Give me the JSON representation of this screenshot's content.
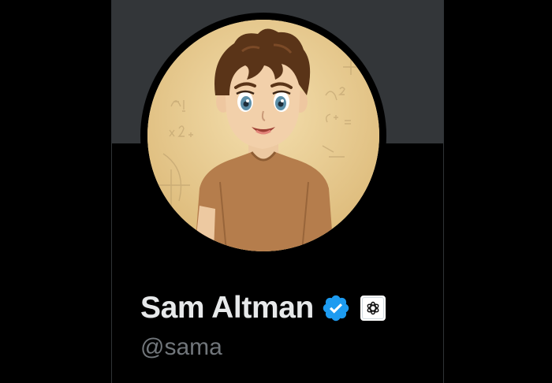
{
  "profile": {
    "display_name": "Sam Altman",
    "handle": "@sama",
    "verified": true,
    "avatar_icon": "anime-portrait-avatar",
    "affiliation_icon": "openai-logo-icon"
  },
  "colors": {
    "background": "#000000",
    "banner": "#333639",
    "name_text": "#e7e9ea",
    "handle_text": "#71767b",
    "verified_badge": "#1d9bf0"
  }
}
